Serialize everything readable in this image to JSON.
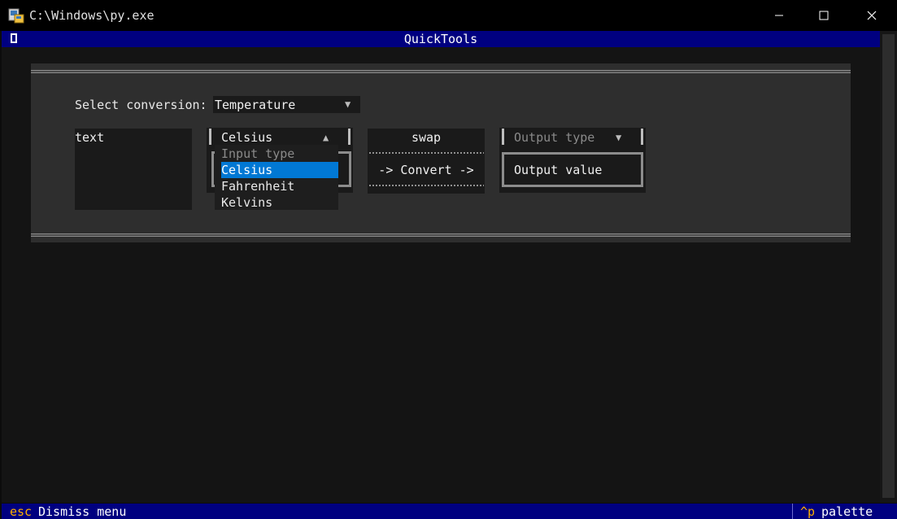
{
  "window": {
    "title": "C:\\Windows\\py.exe",
    "controls": {
      "minimize": "minimize-icon",
      "maximize": "maximize-icon",
      "close": "close-icon"
    }
  },
  "header": {
    "title": "QuickTools",
    "icon": "header-icon"
  },
  "converter": {
    "select_label": "Select conversion: ",
    "conversion_value": "Temperature",
    "input_text": "text",
    "input_type_selected": "Celsius",
    "input_type_options": [
      "Input type",
      "Celsius",
      "Fahrenheit",
      "Kelvins"
    ],
    "swap_label": "swap",
    "convert_label": "-> Convert ->",
    "output_type_placeholder": "Output type",
    "output_value": "Output value",
    "arrow_down": "▼",
    "arrow_up": "▲"
  },
  "footer": {
    "key1": "esc",
    "desc1": "Dismiss menu",
    "key2": "^p",
    "desc2": "palette"
  },
  "colors": {
    "header_bg": "#000080",
    "highlight": "#0178d4",
    "key_accent": "#ffb000",
    "panel": "#2e2e2e",
    "background": "#141414"
  }
}
